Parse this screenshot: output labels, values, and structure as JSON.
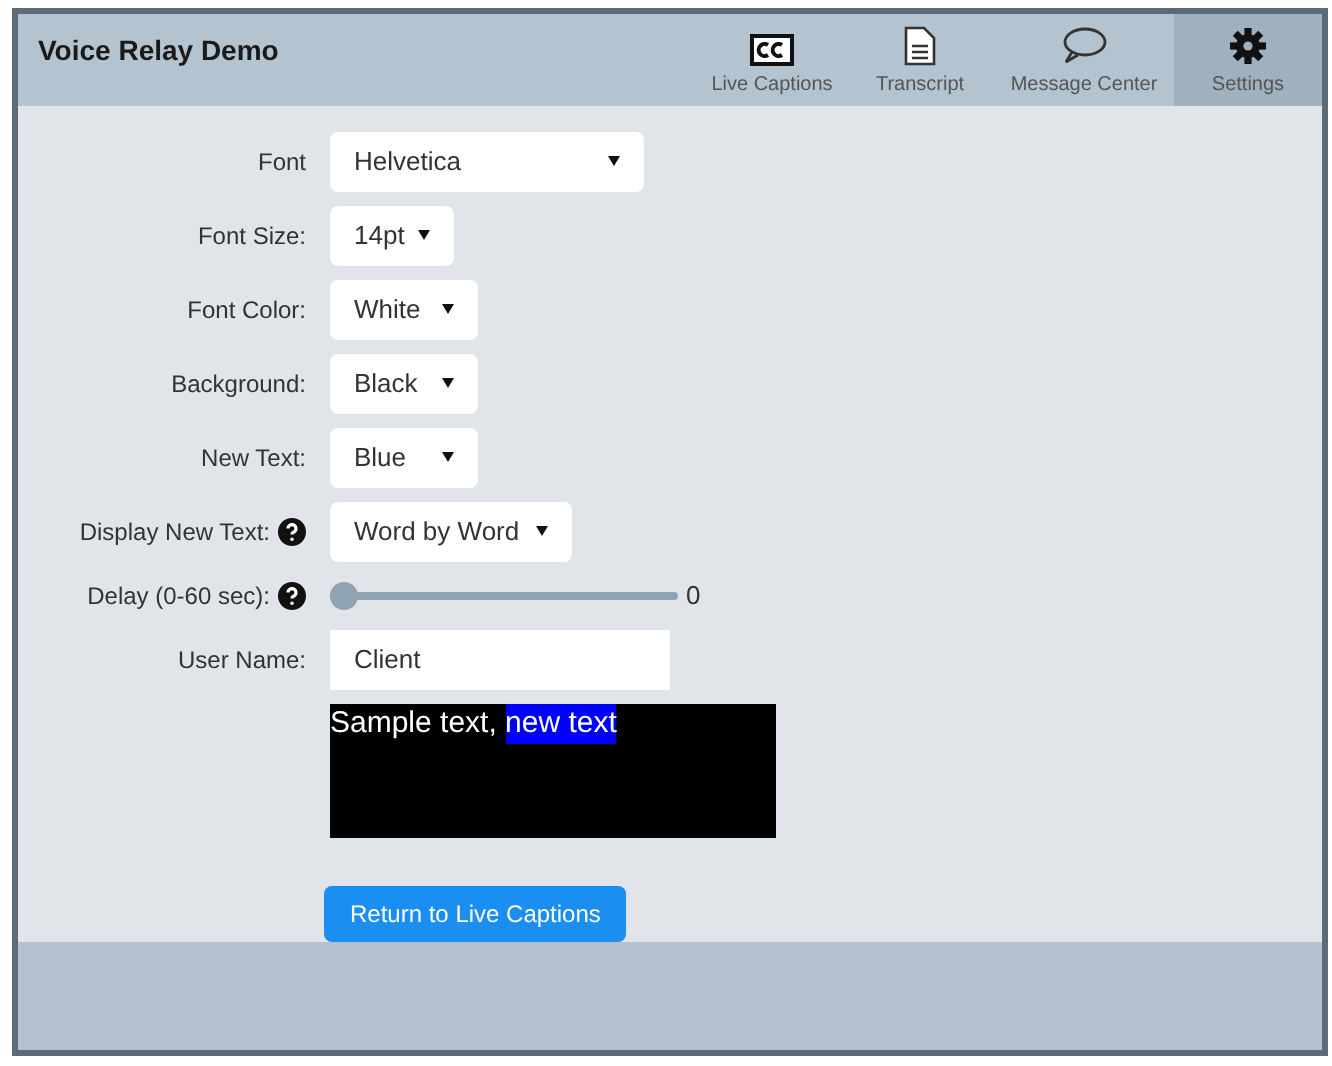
{
  "window": {
    "title": "Voice Relay Demo"
  },
  "tabs": [
    {
      "label": "Live Captions",
      "selected": false
    },
    {
      "label": "Transcript",
      "selected": false
    },
    {
      "label": "Message Center",
      "selected": false
    },
    {
      "label": "Settings",
      "selected": true
    }
  ],
  "settings": [
    {
      "kind": "select",
      "label": "Font",
      "value": "Helvetica",
      "help": false
    },
    {
      "kind": "select",
      "label": "Font Size:",
      "value": "14pt",
      "help": false
    },
    {
      "kind": "select",
      "label": "Font Color:",
      "value": "White",
      "help": false
    },
    {
      "kind": "select",
      "label": "Background:",
      "value": "Black",
      "help": false
    },
    {
      "kind": "select",
      "label": "New Text:",
      "value": "Blue",
      "help": false
    },
    {
      "kind": "select",
      "label": "Display New Text:",
      "value": "Word by Word",
      "help": true
    },
    {
      "kind": "slider",
      "label": "Delay (0-60 sec):",
      "level": 0,
      "reading": "0",
      "help": true
    },
    {
      "kind": "text",
      "label": "User Name:",
      "value": "Client",
      "help": false
    }
  ],
  "preview": {
    "sample_text": "Sample text,",
    "new_text": "new text"
  },
  "button": "Return to Live Captions"
}
